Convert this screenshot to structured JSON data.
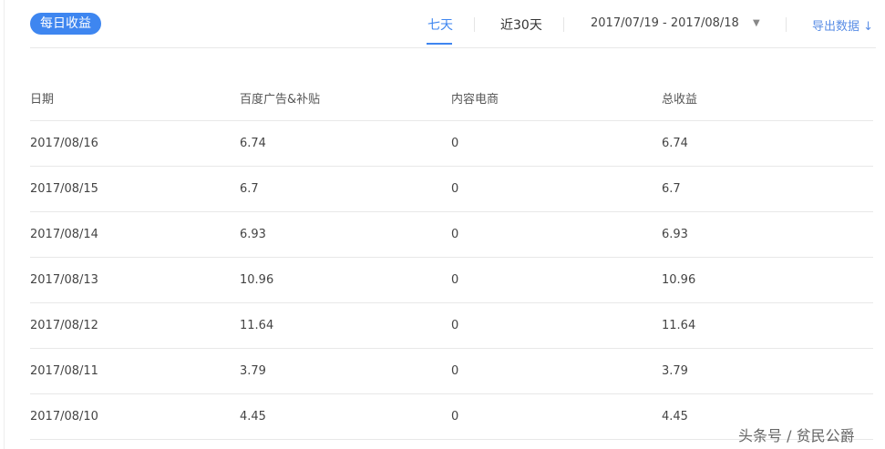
{
  "badge": "每日收益",
  "tabs": [
    "七天",
    "近30天"
  ],
  "date_range": "2017/07/19 - 2017/08/18",
  "export": "导出数据 ↓",
  "columns": [
    "日期",
    "百度广告&补贴",
    "内容电商",
    "总收益"
  ],
  "rows": [
    [
      "2017/08/16",
      "6.74",
      "0",
      "6.74"
    ],
    [
      "2017/08/15",
      "6.7",
      "0",
      "6.7"
    ],
    [
      "2017/08/14",
      "6.93",
      "0",
      "6.93"
    ],
    [
      "2017/08/13",
      "10.96",
      "0",
      "10.96"
    ],
    [
      "2017/08/12",
      "11.64",
      "0",
      "11.64"
    ],
    [
      "2017/08/11",
      "3.79",
      "0",
      "3.79"
    ],
    [
      "2017/08/10",
      "4.45",
      "0",
      "4.45"
    ]
  ],
  "watermark": "头条号 / 贫民公爵"
}
